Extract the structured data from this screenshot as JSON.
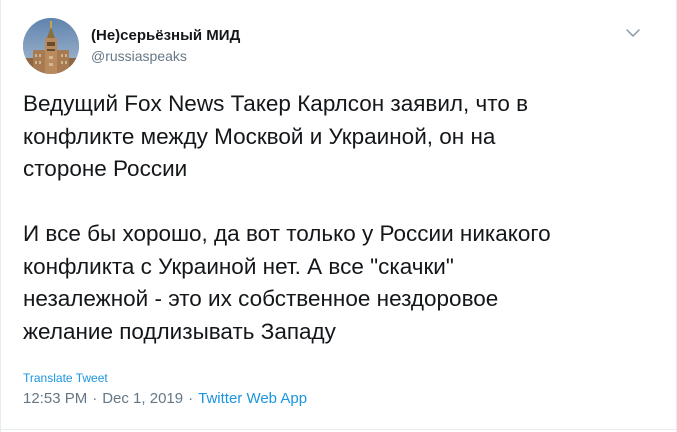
{
  "author": {
    "display_name": "(Не)серьёзный МИД",
    "username": "@russiaspeaks",
    "avatar_icon": "building-tower-icon"
  },
  "menu": {
    "icon": "chevron-down-icon"
  },
  "tweet": {
    "text": "Ведущий Fox News Такер Карлсон заявил, что в\nконфликте между Москвой и Украиной, он на\nстороне России\n\nИ все бы хорошо, да вот только у России никакого\nконфликта с Украиной нет. А все \"скачки\"\nнезалежной - это их собственное нездоровое\nжелание подлизывать Западу",
    "translate_label": "Translate Tweet",
    "time": "12:53 PM",
    "date": "Dec 1, 2019",
    "separator": "·",
    "source_app": "Twitter Web App"
  },
  "colors": {
    "text": "#14171a",
    "secondary": "#657786",
    "link": "#1b95e0",
    "border": "#e6ecf0"
  }
}
